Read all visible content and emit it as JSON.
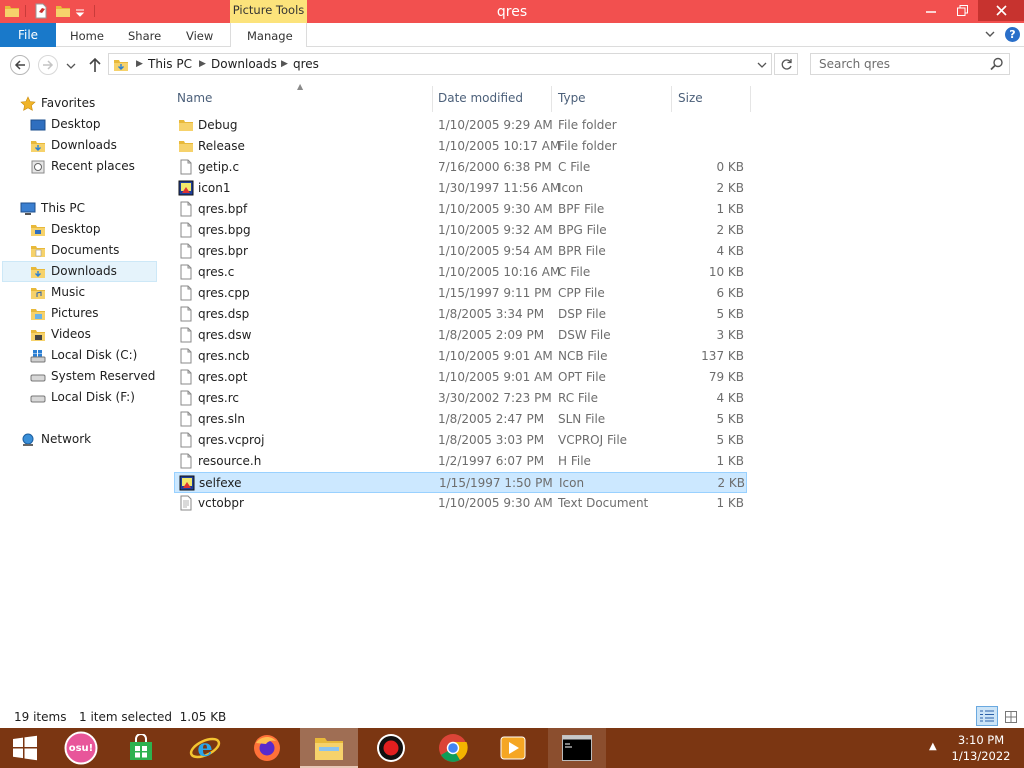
{
  "window": {
    "title": "qres",
    "context_tab": "Picture Tools"
  },
  "ribbon": {
    "tabs": [
      "File",
      "Home",
      "Share",
      "View",
      "Manage"
    ]
  },
  "address": {
    "crumbs": [
      "This PC",
      "Downloads",
      "qres"
    ],
    "search_placeholder": "Search qres"
  },
  "nav": {
    "favorites": {
      "label": "Favorites",
      "items": [
        "Desktop",
        "Downloads",
        "Recent places"
      ]
    },
    "this_pc": {
      "label": "This PC",
      "items": [
        "Desktop",
        "Documents",
        "Downloads",
        "Music",
        "Pictures",
        "Videos",
        "Local Disk (C:)",
        "System Reserved (D:",
        "Local Disk (F:)"
      ]
    },
    "network": {
      "label": "Network"
    },
    "selected": "Downloads"
  },
  "columns": {
    "name": "Name",
    "date": "Date modified",
    "type": "Type",
    "size": "Size"
  },
  "files": [
    {
      "name": "Debug",
      "date": "1/10/2005 9:29 AM",
      "type": "File folder",
      "size": "",
      "icon": "folder"
    },
    {
      "name": "Release",
      "date": "1/10/2005 10:17 AM",
      "type": "File folder",
      "size": "",
      "icon": "folder"
    },
    {
      "name": "getip.c",
      "date": "7/16/2000 6:38 PM",
      "type": "C File",
      "size": "0 KB",
      "icon": "file"
    },
    {
      "name": "icon1",
      "date": "1/30/1997 11:56 AM",
      "type": "Icon",
      "size": "2 KB",
      "icon": "icon-image"
    },
    {
      "name": "qres.bpf",
      "date": "1/10/2005 9:30 AM",
      "type": "BPF File",
      "size": "1 KB",
      "icon": "file"
    },
    {
      "name": "qres.bpg",
      "date": "1/10/2005 9:32 AM",
      "type": "BPG File",
      "size": "2 KB",
      "icon": "file"
    },
    {
      "name": "qres.bpr",
      "date": "1/10/2005 9:54 AM",
      "type": "BPR File",
      "size": "4 KB",
      "icon": "file"
    },
    {
      "name": "qres.c",
      "date": "1/10/2005 10:16 AM",
      "type": "C File",
      "size": "10 KB",
      "icon": "file"
    },
    {
      "name": "qres.cpp",
      "date": "1/15/1997 9:11 PM",
      "type": "CPP File",
      "size": "6 KB",
      "icon": "file"
    },
    {
      "name": "qres.dsp",
      "date": "1/8/2005 3:34 PM",
      "type": "DSP File",
      "size": "5 KB",
      "icon": "file"
    },
    {
      "name": "qres.dsw",
      "date": "1/8/2005 2:09 PM",
      "type": "DSW File",
      "size": "3 KB",
      "icon": "file"
    },
    {
      "name": "qres.ncb",
      "date": "1/10/2005 9:01 AM",
      "type": "NCB File",
      "size": "137 KB",
      "icon": "file"
    },
    {
      "name": "qres.opt",
      "date": "1/10/2005 9:01 AM",
      "type": "OPT File",
      "size": "79 KB",
      "icon": "file"
    },
    {
      "name": "qres.rc",
      "date": "3/30/2002 7:23 PM",
      "type": "RC File",
      "size": "4 KB",
      "icon": "file"
    },
    {
      "name": "qres.sln",
      "date": "1/8/2005 2:47 PM",
      "type": "SLN File",
      "size": "5 KB",
      "icon": "file"
    },
    {
      "name": "qres.vcproj",
      "date": "1/8/2005 3:03 PM",
      "type": "VCPROJ File",
      "size": "5 KB",
      "icon": "file"
    },
    {
      "name": "resource.h",
      "date": "1/2/1997 6:07 PM",
      "type": "H File",
      "size": "1 KB",
      "icon": "file"
    },
    {
      "name": "selfexe",
      "date": "1/15/1997 1:50 PM",
      "type": "Icon",
      "size": "2 KB",
      "icon": "icon-image",
      "selected": true
    },
    {
      "name": "vctobpr",
      "date": "1/10/2005 9:30 AM",
      "type": "Text Document",
      "size": "1 KB",
      "icon": "text-doc"
    }
  ],
  "status": {
    "count": "19 items",
    "selection": "1 item selected  1.05 KB"
  },
  "taskbar": {
    "icons": [
      "start-icon",
      "osu-icon",
      "store-icon",
      "ie-icon",
      "firefox-icon",
      "file-explorer-icon",
      "obs-icon",
      "chrome-icon",
      "media-player-icon",
      "cmd-icon"
    ],
    "osu_label": "osu!",
    "time": "3:10 PM",
    "date": "1/13/2022"
  },
  "colors": {
    "titlebar": "#f2504f",
    "file_tab": "#1979ca",
    "context_tab": "#fce37b",
    "taskbar": "#7b3612",
    "selection": "#cce8ff"
  }
}
